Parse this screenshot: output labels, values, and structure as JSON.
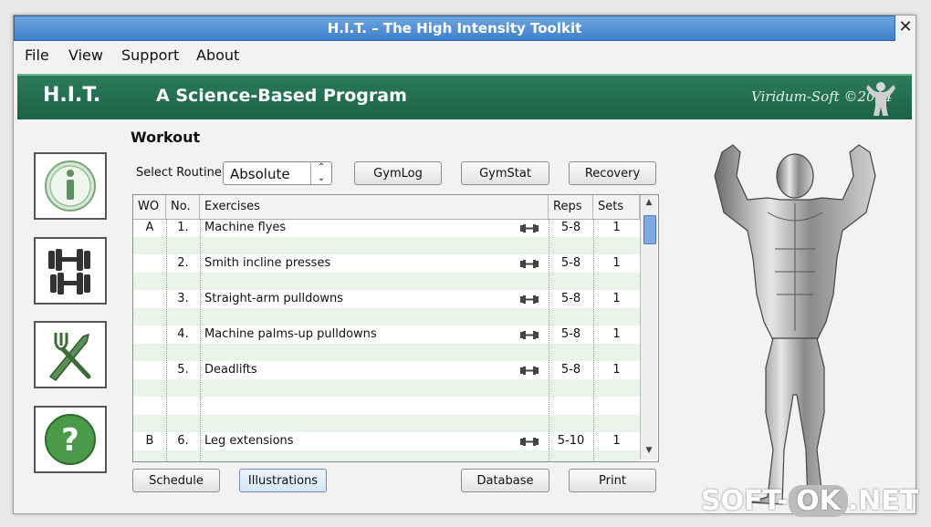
{
  "window": {
    "title": "H.I.T. – The High Intensity Toolkit",
    "close_glyph": "✕"
  },
  "menu": [
    "File",
    "View",
    "Support",
    "About"
  ],
  "banner": {
    "short_name": "H.I.T.",
    "tagline": "A Science-Based Program",
    "copyright": "Viridum-Soft ©2014"
  },
  "sidebar": [
    {
      "name": "info",
      "icon": "info-icon"
    },
    {
      "name": "workout",
      "icon": "dumbbell-icon"
    },
    {
      "name": "nutrition",
      "icon": "fork-knife-icon"
    },
    {
      "name": "help",
      "icon": "help-icon"
    }
  ],
  "workout": {
    "title": "Workout",
    "routine_label": "Select Routine:",
    "routine_value": "Absolute",
    "buttons_top": [
      "GymLog",
      "GymStat",
      "Recovery"
    ],
    "columns": [
      "WO",
      "No.",
      "Exercises",
      "Reps",
      "Sets"
    ],
    "rows": [
      {
        "wo": "A",
        "no": "1.",
        "exercise": "Machine flyes",
        "reps": "5-8",
        "sets": "1",
        "icon": true
      },
      {
        "wo": "",
        "no": "",
        "exercise": "",
        "reps": "",
        "sets": "",
        "icon": false
      },
      {
        "wo": "",
        "no": "2.",
        "exercise": "Smith incline presses",
        "reps": "5-8",
        "sets": "1",
        "icon": true
      },
      {
        "wo": "",
        "no": "",
        "exercise": "",
        "reps": "",
        "sets": "",
        "icon": false
      },
      {
        "wo": "",
        "no": "3.",
        "exercise": "Straight-arm pulldowns",
        "reps": "5-8",
        "sets": "1",
        "icon": true
      },
      {
        "wo": "",
        "no": "",
        "exercise": "",
        "reps": "",
        "sets": "",
        "icon": false
      },
      {
        "wo": "",
        "no": "4.",
        "exercise": "Machine palms-up pulldowns",
        "reps": "5-8",
        "sets": "1",
        "icon": true
      },
      {
        "wo": "",
        "no": "",
        "exercise": "",
        "reps": "",
        "sets": "",
        "icon": false
      },
      {
        "wo": "",
        "no": "5.",
        "exercise": "Deadlifts",
        "reps": "5-8",
        "sets": "1",
        "icon": true
      },
      {
        "wo": "",
        "no": "",
        "exercise": "",
        "reps": "",
        "sets": "",
        "icon": false
      },
      {
        "wo": "",
        "no": "",
        "exercise": "",
        "reps": "",
        "sets": "",
        "icon": false
      },
      {
        "wo": "",
        "no": "",
        "exercise": "",
        "reps": "",
        "sets": "",
        "icon": false
      },
      {
        "wo": "B",
        "no": "6.",
        "exercise": "Leg extensions",
        "reps": "5-10",
        "sets": "1",
        "icon": true
      },
      {
        "wo": "",
        "no": "",
        "exercise": "",
        "reps": "",
        "sets": "",
        "icon": false
      }
    ],
    "buttons_bottom": [
      "Schedule",
      "Illustrations",
      "Database",
      "Print"
    ]
  },
  "watermark": {
    "left": "SOFT-",
    "mid": "OK",
    "right": ".NET"
  }
}
